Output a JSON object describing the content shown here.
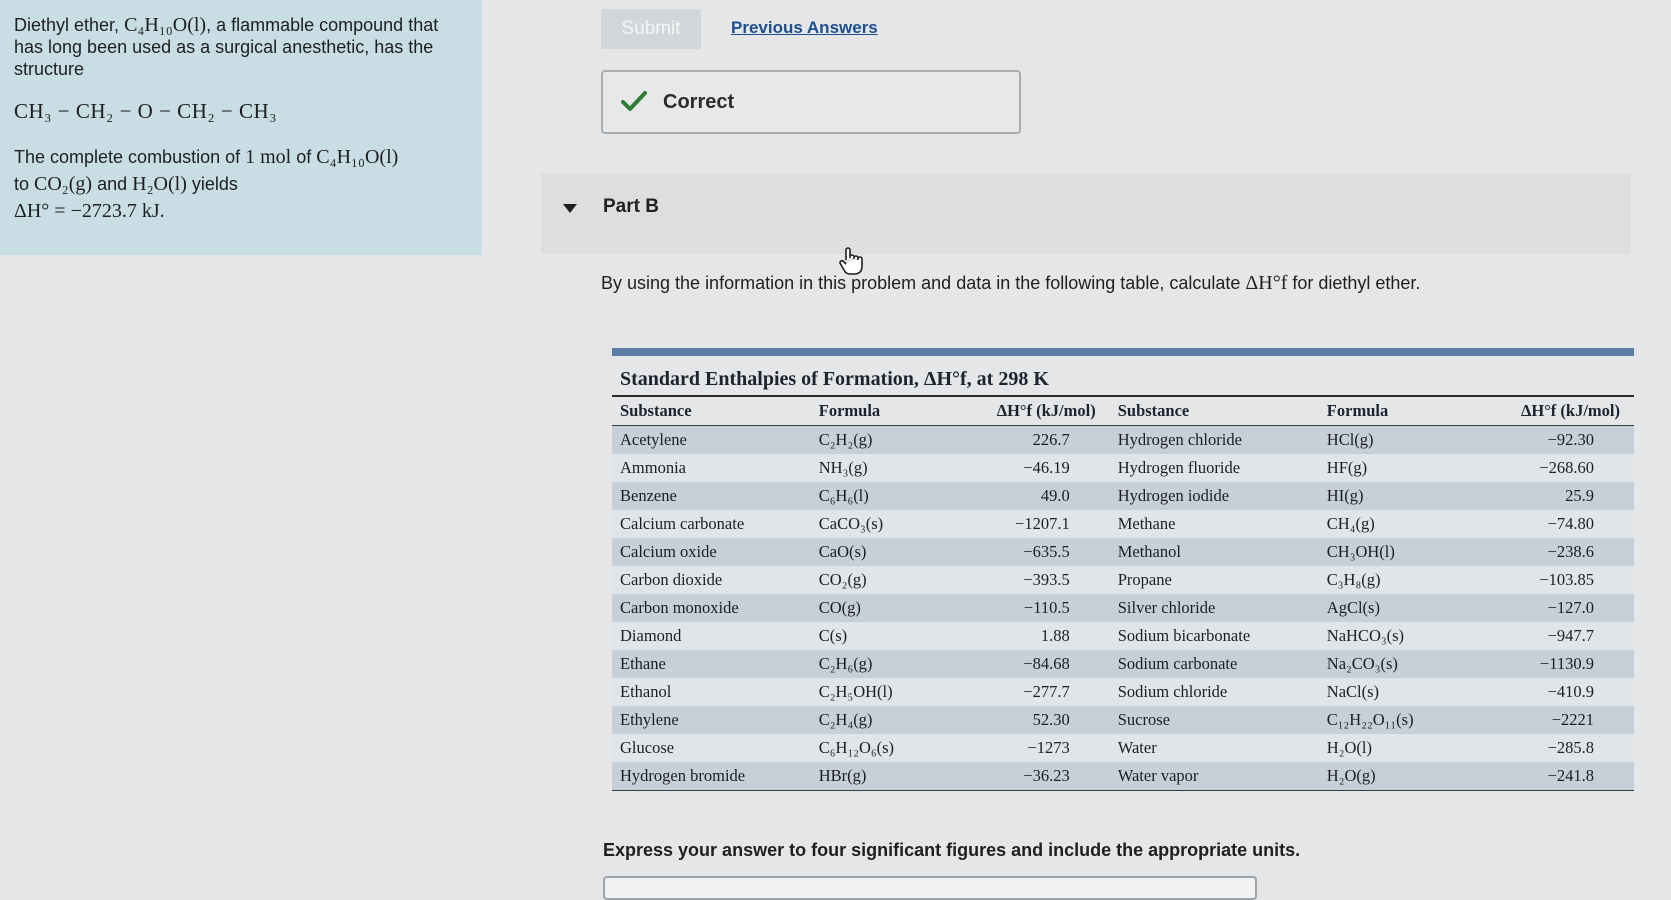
{
  "problem": {
    "intro_text_1": "Diethyl ether, ",
    "intro_formula": "C₄H₁₀O(l)",
    "intro_text_2": ", a flammable compound that has long been used as a surgical anesthetic, has the structure",
    "structure": "CH₃ − CH₂ − O − CH₂ − CH₃",
    "combustion_text_1": "The complete combustion of ",
    "combustion_amount": "1 mol",
    "combustion_text_2": " of ",
    "combustion_formula": "C₄H₁₀O(l)",
    "combustion_text_3": " to ",
    "product_co2": "CO₂(g)",
    "combustion_and": " and ",
    "product_h2o": "H₂O(l)",
    "combustion_yields": " yields",
    "enthalpy": "ΔH° = −2723.7 kJ."
  },
  "actions": {
    "submit_label": "Submit",
    "previous_answers_label": "Previous Answers"
  },
  "feedback": {
    "status_label": "Correct",
    "status_color": "#2e7d32"
  },
  "part": {
    "label": "Part B",
    "question_prefix": "By using the information in this problem and data in the following table, calculate ",
    "question_symbol": "ΔH°f",
    "question_suffix": " for diethyl ether."
  },
  "table": {
    "title": "Standard Enthalpies of Formation, ΔH°f, at 298 K",
    "headers": [
      "Substance",
      "Formula",
      "ΔH°f (kJ/mol)",
      "Substance",
      "Formula",
      "ΔH°f (kJ/mol)"
    ],
    "rows": [
      [
        "Acetylene",
        "C₂H₂(g)",
        "226.7",
        "Hydrogen chloride",
        "HCl(g)",
        "−92.30"
      ],
      [
        "Ammonia",
        "NH₃(g)",
        "−46.19",
        "Hydrogen fluoride",
        "HF(g)",
        "−268.60"
      ],
      [
        "Benzene",
        "C₆H₆(l)",
        "49.0",
        "Hydrogen iodide",
        "HI(g)",
        "25.9"
      ],
      [
        "Calcium carbonate",
        "CaCO₃(s)",
        "−1207.1",
        "Methane",
        "CH₄(g)",
        "−74.80"
      ],
      [
        "Calcium oxide",
        "CaO(s)",
        "−635.5",
        "Methanol",
        "CH₃OH(l)",
        "−238.6"
      ],
      [
        "Carbon dioxide",
        "CO₂(g)",
        "−393.5",
        "Propane",
        "C₃H₈(g)",
        "−103.85"
      ],
      [
        "Carbon monoxide",
        "CO(g)",
        "−110.5",
        "Silver chloride",
        "AgCl(s)",
        "−127.0"
      ],
      [
        "Diamond",
        "C(s)",
        "1.88",
        "Sodium bicarbonate",
        "NaHCO₃(s)",
        "−947.7"
      ],
      [
        "Ethane",
        "C₂H₆(g)",
        "−84.68",
        "Sodium carbonate",
        "Na₂CO₃(s)",
        "−1130.9"
      ],
      [
        "Ethanol",
        "C₂H₅OH(l)",
        "−277.7",
        "Sodium chloride",
        "NaCl(s)",
        "−410.9"
      ],
      [
        "Ethylene",
        "C₂H₄(g)",
        "52.30",
        "Sucrose",
        "C₁₂H₂₂O₁₁(s)",
        "−2221"
      ],
      [
        "Glucose",
        "C₆H₁₂O₆(s)",
        "−1273",
        "Water",
        "H₂O(l)",
        "−285.8"
      ],
      [
        "Hydrogen bromide",
        "HBr(g)",
        "−36.23",
        "Water vapor",
        "H₂O(g)",
        "−241.8"
      ]
    ]
  },
  "answer": {
    "instruction": "Express your answer to four significant figures and include the appropriate units."
  }
}
